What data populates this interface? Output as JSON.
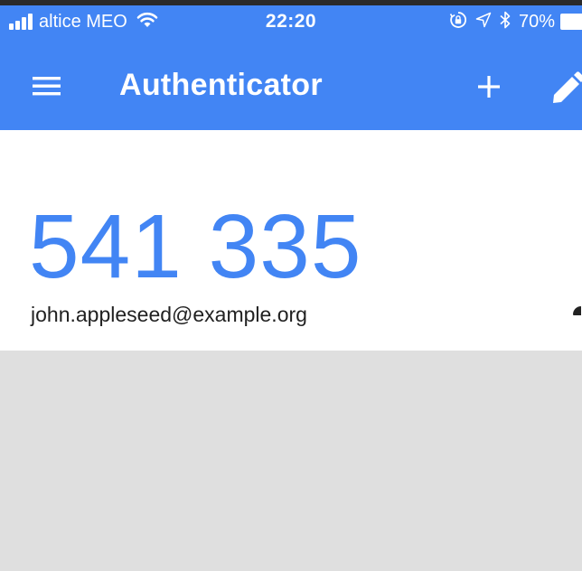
{
  "status_bar": {
    "carrier": "altice MEO",
    "time": "22:20",
    "battery_percent": "70%",
    "icons": [
      "signal-icon",
      "wifi-icon",
      "orientation-lock-icon",
      "location-icon",
      "bluetooth-icon",
      "battery-icon"
    ]
  },
  "app_bar": {
    "title": "Authenticator",
    "icons": [
      "menu-icon",
      "add-icon",
      "edit-icon"
    ]
  },
  "accounts": [
    {
      "code": "541 335",
      "name": "john.appleseed@example.org"
    }
  ],
  "colors": {
    "accent": "#4285f4",
    "card_background": "#ffffff",
    "page_background": "#dfdfdf",
    "text_primary": "#212121"
  }
}
